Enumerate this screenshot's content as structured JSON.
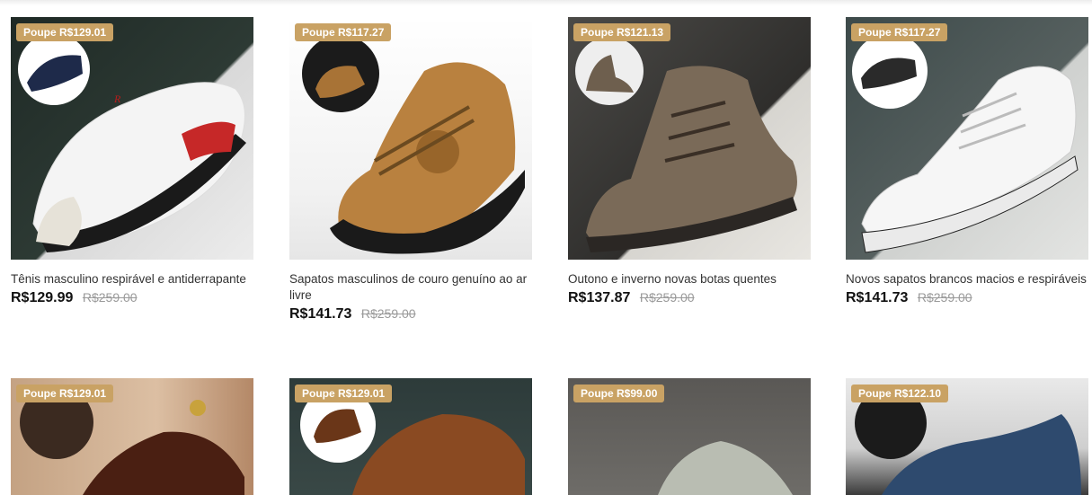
{
  "products": [
    {
      "badge": "Poupe R$129.01",
      "title": "Tênis masculino respirável e antiderrapante",
      "price": "R$129.99",
      "old_price": "R$259.00"
    },
    {
      "badge": "Poupe R$117.27",
      "title": "Sapatos masculinos de couro genuíno ao ar livre",
      "price": "R$141.73",
      "old_price": "R$259.00"
    },
    {
      "badge": "Poupe R$121.13",
      "title": "Outono e inverno novas botas quentes",
      "price": "R$137.87",
      "old_price": "R$259.00"
    },
    {
      "badge": "Poupe R$117.27",
      "title": "Novos sapatos brancos macios e respiráveis",
      "price": "R$141.73",
      "old_price": "R$259.00"
    },
    {
      "badge": "Poupe R$129.01"
    },
    {
      "badge": "Poupe R$129.01"
    },
    {
      "badge": "Poupe R$99.00"
    },
    {
      "badge": "Poupe R$122.10"
    }
  ],
  "colors": {
    "badge": "#c9a264",
    "price": "#111111",
    "old_price": "#9a9a9a"
  }
}
